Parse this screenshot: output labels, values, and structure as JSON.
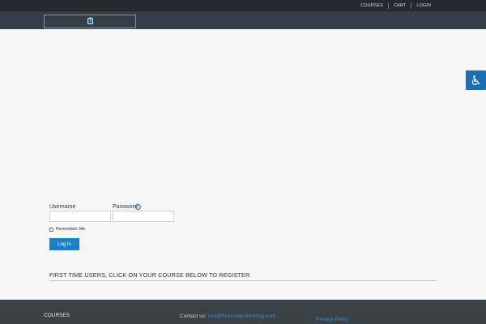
{
  "topnav": {
    "courses": "COURSES",
    "cart": "CART",
    "login": "LOGIN"
  },
  "header": {
    "logo_icon": "broken-image-icon"
  },
  "accessibility": {
    "icon": "wheelchair-icon",
    "glyph": "♿"
  },
  "login_form": {
    "username_label": "Username",
    "password_label": "Password",
    "help_glyph": "?",
    "username_value": "",
    "password_value": "",
    "remember_label": "Remember Me",
    "submit_label": "Log In"
  },
  "register": {
    "heading": "FIRST TIME USERS, CLICK ON YOUR COURSE BELOW TO REGISTER"
  },
  "footer": {
    "courses_label": "COURSES",
    "contact_prefix": "Contact us:",
    "contact_email": "info@fourmilepublishing.com",
    "privacy_label": "Privacy Policy"
  },
  "colors": {
    "accent": "#1e7fc4",
    "topbar": "#23292d",
    "header": "#353e44",
    "footer": "#3a4247"
  }
}
